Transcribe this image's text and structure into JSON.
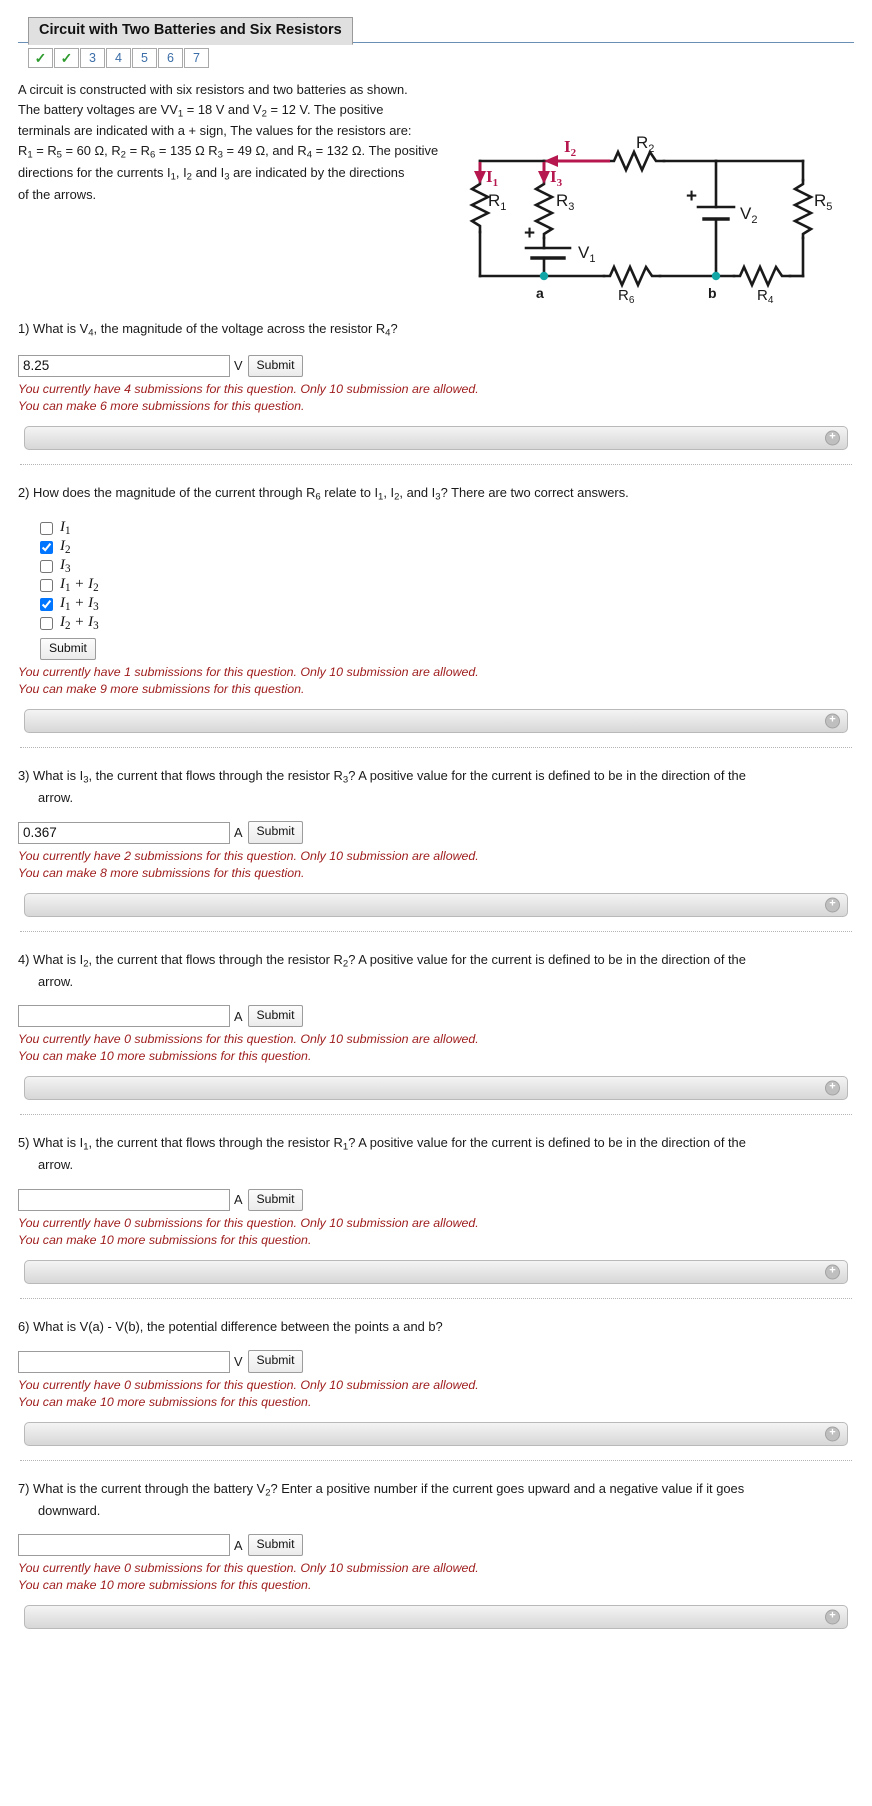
{
  "header": {
    "title": "Circuit with Two Batteries and Six Resistors",
    "tabs": [
      {
        "label": "✓",
        "state": "done"
      },
      {
        "label": "✓",
        "state": "done"
      },
      {
        "label": "3",
        "state": "todo"
      },
      {
        "label": "4",
        "state": "todo"
      },
      {
        "label": "5",
        "state": "todo"
      },
      {
        "label": "6",
        "state": "todo"
      },
      {
        "label": "7",
        "state": "todo"
      }
    ]
  },
  "intro": {
    "line1": "A circuit is constructed with six resistors and two batteries as shown.",
    "line2_a": "The battery voltages are V",
    "line2_b": " = 18 V and V",
    "line2_c": " = 12 V. The positive",
    "line3": "terminals are indicated with a + sign, The values for the resistors are:",
    "line4_a": "R",
    "line4_b": " = R",
    "line4_c": " = 60 Ω, R",
    "line4_d": " = R",
    "line4_e": " = 135 Ω R",
    "line4_f": " = 49 Ω, and R",
    "line4_g": " = 132 Ω. The positive",
    "line5_a": "directions for the currents I",
    "line5_b": ", I",
    "line5_c": " and I",
    "line5_d": " are indicated by the directions",
    "line6": "of the arrows."
  },
  "circuit": {
    "labels": {
      "r1": "R",
      "r1s": "1",
      "r2": "R",
      "r2s": "2",
      "r3": "R",
      "r3s": "3",
      "r4": "R",
      "r4s": "4",
      "r5": "R",
      "r5s": "5",
      "r6": "R",
      "r6s": "6",
      "v1": "V",
      "v1s": "1",
      "v2": "V",
      "v2s": "2",
      "i1": "I",
      "i1s": "1",
      "i2": "I",
      "i2s": "2",
      "i3": "I",
      "i3s": "3",
      "node_a": "a",
      "node_b": "b",
      "plus": "+"
    },
    "colors": {
      "current_arrow": "#b5174e",
      "wire": "#1a1a1a",
      "node_dot": "#12a5a5"
    }
  },
  "questions": [
    {
      "number": "1)",
      "text_pre": "What is V",
      "text_sub1": "4",
      "text_mid": ", the magnitude of the voltage across the resistor R",
      "text_sub2": "4",
      "text_post": "?",
      "type": "numeric",
      "value": "8.25",
      "placeholder": "",
      "unit": "V",
      "submit_label": "Submit",
      "msg1": "You currently have 4 submissions for this question. Only 10 submission are allowed.",
      "msg2": "You can make 6 more submissions for this question."
    },
    {
      "number": "2)",
      "text_pre": "How does the magnitude of the current through R",
      "text_sub1": "6",
      "text_mid": " relate to I",
      "text_sub2": "1",
      "text_mid2": ", I",
      "text_sub3": "2",
      "text_mid3": ", and I",
      "text_sub4": "3",
      "text_post": "? There are two correct answers.",
      "type": "checkbox",
      "choices": [
        {
          "label_main": "I",
          "label_sub": "1",
          "label_extra": "",
          "checked": false
        },
        {
          "label_main": "I",
          "label_sub": "2",
          "label_extra": "",
          "checked": true
        },
        {
          "label_main": "I",
          "label_sub": "3",
          "label_extra": "",
          "checked": false
        },
        {
          "label_main": "I",
          "label_sub": "1",
          "label_extra": " + I",
          "label_sub2": "2",
          "checked": false
        },
        {
          "label_main": "I",
          "label_sub": "1",
          "label_extra": " + I",
          "label_sub2": "3",
          "checked": true
        },
        {
          "label_main": "I",
          "label_sub": "2",
          "label_extra": " + I",
          "label_sub2": "3",
          "checked": false
        }
      ],
      "submit_label": "Submit",
      "msg1": "You currently have 1 submissions for this question. Only 10 submission are allowed.",
      "msg2": "You can make 9 more submissions for this question."
    },
    {
      "number": "3)",
      "text_pre": "What is I",
      "text_sub1": "3",
      "text_mid": ", the current that flows through the resistor R",
      "text_sub2": "3",
      "text_post": "? A positive value for the current is defined to be in the",
      "text_line2": "direction of the arrow.",
      "type": "numeric",
      "value": "0.367",
      "placeholder": "",
      "unit": "A",
      "submit_label": "Submit",
      "msg1": "You currently have 2 submissions for this question. Only 10 submission are allowed.",
      "msg2": "You can make 8 more submissions for this question."
    },
    {
      "number": "4)",
      "text_pre": "What is I",
      "text_sub1": "2",
      "text_mid": ", the current that flows through the resistor R",
      "text_sub2": "2",
      "text_post": "? A positive value for the current is defined to be in the",
      "text_line2": "direction of the arrow.",
      "type": "numeric",
      "value": "",
      "placeholder": "",
      "unit": "A",
      "submit_label": "Submit",
      "msg1": "You currently have 0 submissions for this question. Only 10 submission are allowed.",
      "msg2": "You can make 10 more submissions for this question."
    },
    {
      "number": "5)",
      "text_pre": "What is I",
      "text_sub1": "1",
      "text_mid": ", the current that flows through the resistor R",
      "text_sub2": "1",
      "text_post": "? A positive value for the current is defined to be in the",
      "text_line2": "direction of the arrow.",
      "type": "numeric",
      "value": "",
      "placeholder": "",
      "unit": "A",
      "submit_label": "Submit",
      "msg1": "You currently have 0 submissions for this question. Only 10 submission are allowed.",
      "msg2": "You can make 10 more submissions for this question."
    },
    {
      "number": "6)",
      "text_plain": "What is V(a) - V(b), the potential difference between the points a and b?",
      "type": "numeric",
      "value": "",
      "placeholder": "",
      "unit": "V",
      "submit_label": "Submit",
      "msg1": "You currently have 0 submissions for this question. Only 10 submission are allowed.",
      "msg2": "You can make 10 more submissions for this question."
    },
    {
      "number": "7)",
      "text_pre": "What is the current through the battery V",
      "text_sub1": "2",
      "text_post": "? Enter a positive number if the current goes upward and a negative value if",
      "text_line2": "it goes downward.",
      "type": "numeric",
      "value": "",
      "placeholder": "",
      "unit": "A",
      "submit_label": "Submit",
      "msg1": "You currently have 0 submissions for this question. Only 10 submission are allowed.",
      "msg2": "You can make 10 more submissions for this question."
    }
  ],
  "expander": {
    "plus_label": "+"
  }
}
